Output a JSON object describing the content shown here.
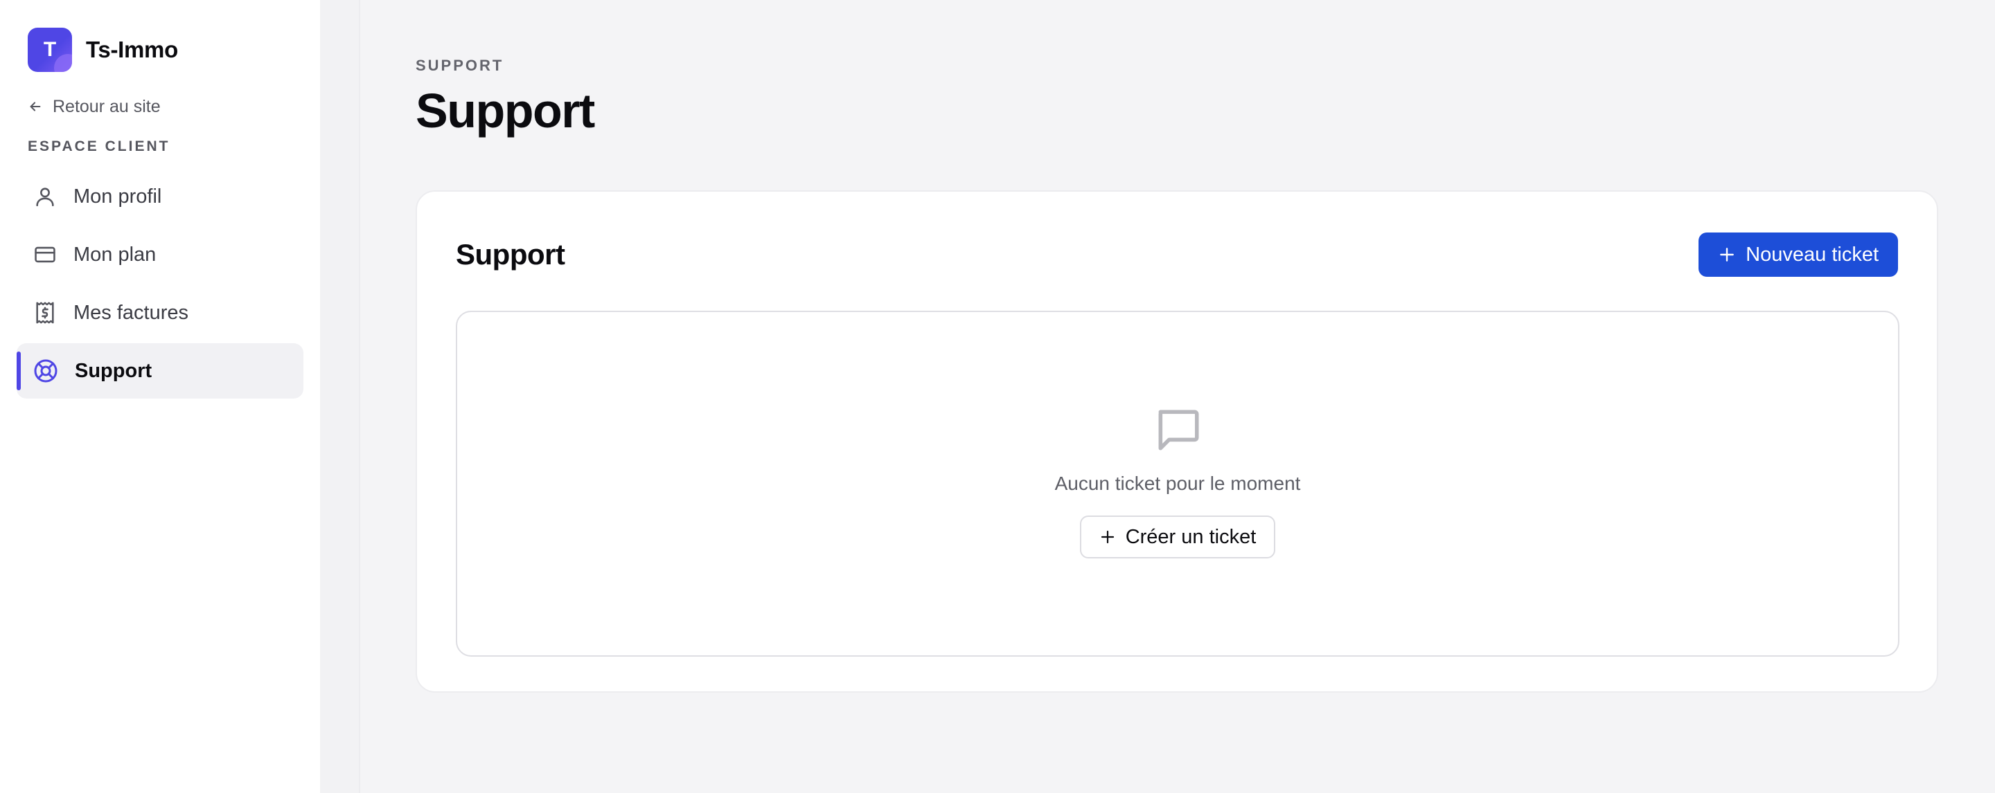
{
  "app": {
    "logo_letter": "T",
    "name": "Ts-Immo"
  },
  "sidebar": {
    "back_link": "Retour au site",
    "section_label": "ESPACE CLIENT",
    "items": [
      {
        "label": "Mon profil",
        "icon": "user-icon",
        "active": false
      },
      {
        "label": "Mon plan",
        "icon": "credit-card-icon",
        "active": false
      },
      {
        "label": "Mes factures",
        "icon": "receipt-dollar-icon",
        "active": false
      },
      {
        "label": "Support",
        "icon": "life-buoy-icon",
        "active": true
      }
    ]
  },
  "main": {
    "eyebrow": "SUPPORT",
    "title": "Support",
    "card": {
      "title": "Support",
      "new_ticket_label": "Nouveau ticket",
      "empty_text": "Aucun ticket pour le moment",
      "create_ticket_label": "Créer un ticket"
    }
  },
  "colors": {
    "accent": "#4f46e5",
    "primary_button": "#1d4ed8",
    "background": "#f4f4f6"
  }
}
